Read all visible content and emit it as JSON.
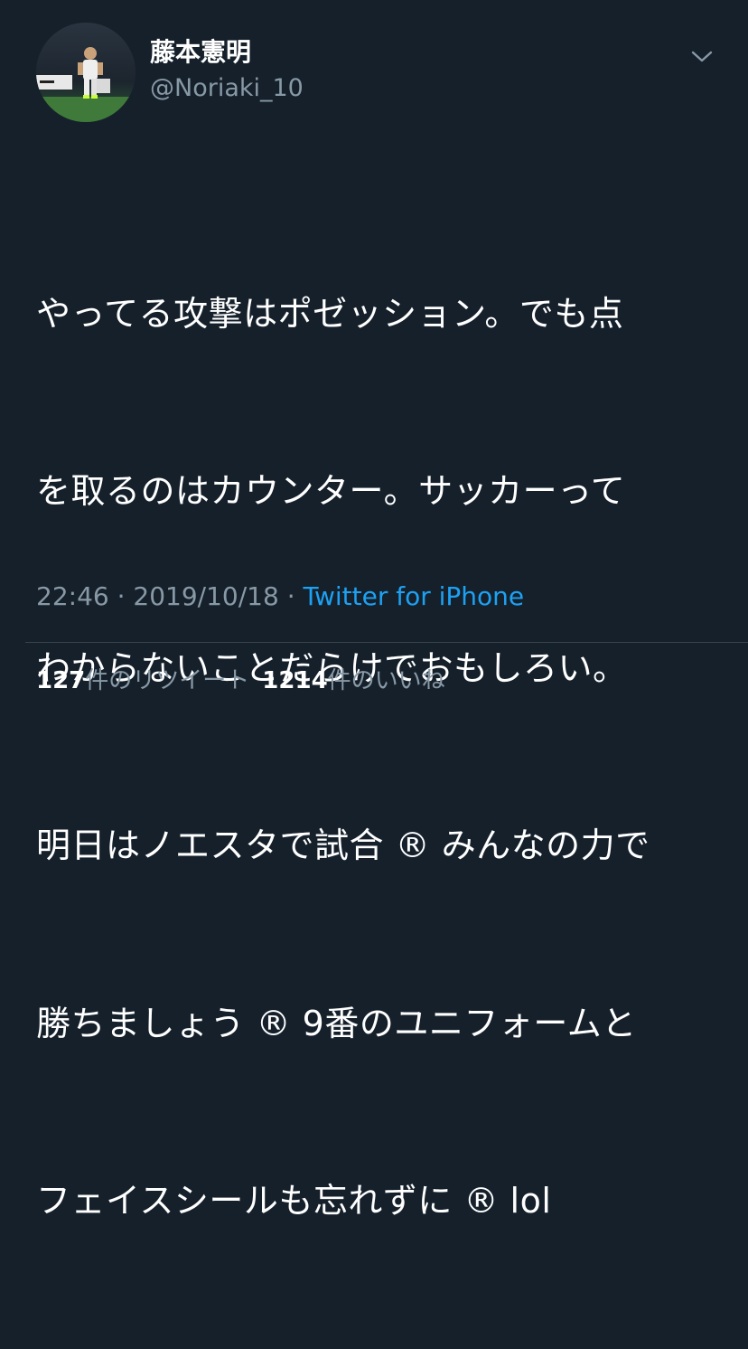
{
  "author": {
    "display_name": "藤本憲明",
    "handle": "@Noriaki_10"
  },
  "menu": {
    "icon": "chevron-down-icon"
  },
  "tweet": {
    "lines": [
      "やってる攻撃はポゼッション。でも点",
      "を取るのはカウンター。サッカーって",
      "わからないことだらけでおもしろい。",
      "明日はノエスタで試合 ® みんなの力で",
      "勝ちましょう ® 9番のユニフォームと",
      "フェイスシールも忘れずに ® lol"
    ]
  },
  "meta": {
    "time": "22:46",
    "sep1": " · ",
    "date": "2019/10/18",
    "sep2": " · ",
    "source": "Twitter for iPhone"
  },
  "stats": {
    "retweets": {
      "count": "127",
      "label": "件のリツイート"
    },
    "likes": {
      "count": "1214",
      "label": "件のいいね"
    }
  },
  "colors": {
    "background": "#15202b",
    "secondary_text": "#8899a6",
    "link": "#1da1f2",
    "divider": "#38444d"
  }
}
